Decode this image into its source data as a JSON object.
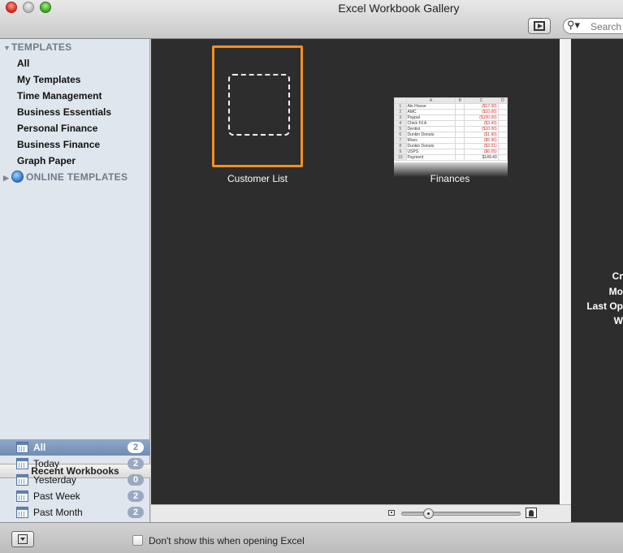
{
  "window": {
    "title": "Excel Workbook Gallery"
  },
  "toolbar": {
    "search_placeholder": "Search",
    "slideshow_icon": "slideshow-icon",
    "search_icon": "magnifier-icon"
  },
  "sidebar": {
    "templates_header": "TEMPLATES",
    "items": [
      "All",
      "My Templates",
      "Time Management",
      "Business Essentials",
      "Personal Finance",
      "Business Finance",
      "Graph Paper"
    ],
    "online_header": "ONLINE TEMPLATES"
  },
  "recent": {
    "header": "Recent Workbooks",
    "items": [
      {
        "label": "All",
        "count": "2"
      },
      {
        "label": "Today",
        "count": "2"
      },
      {
        "label": "Yesterday",
        "count": "0"
      },
      {
        "label": "Past Week",
        "count": "2"
      },
      {
        "label": "Past Month",
        "count": "2"
      }
    ]
  },
  "gallery": {
    "tiles": [
      {
        "label": "Customer List",
        "selected": true
      },
      {
        "label": "Finances",
        "selected": false
      }
    ],
    "finances_sheet": {
      "columns": [
        "",
        "A",
        "B",
        "C",
        "D"
      ],
      "rows": [
        [
          "1",
          "Ale House",
          "",
          "($17.00)",
          ""
        ],
        [
          "2",
          "AMC",
          "",
          "($10.00)",
          ""
        ],
        [
          "3",
          "Paypal",
          "",
          "($100.00)",
          ""
        ],
        [
          "4",
          "Chick Fil A",
          "",
          "($3.43)",
          ""
        ],
        [
          "5",
          "Dentist",
          "",
          "($10.00)",
          ""
        ],
        [
          "6",
          "Dunkin Donuts",
          "",
          "($1.90)",
          ""
        ],
        [
          "7",
          "Moes",
          "",
          "($5.96)",
          ""
        ],
        [
          "8",
          "Dunkin Donuts",
          "",
          "($2.01)",
          ""
        ],
        [
          "9",
          "USPS",
          "",
          "($6.05)",
          ""
        ],
        [
          "10",
          "Payment",
          "",
          "$149.43",
          ""
        ]
      ]
    }
  },
  "detail": {
    "labels": [
      "Cr",
      "Mo",
      "Last Op",
      "W"
    ]
  },
  "zoom": {
    "level": 0.2
  },
  "bottom": {
    "checkbox_label": "Don't show this when opening Excel",
    "checked": false
  },
  "colors": {
    "selection_orange": "#f2901f",
    "gallery_bg": "#2d2d2d",
    "sidebar_bg": "#e0e6ee",
    "negative_red": "#d0302a"
  }
}
